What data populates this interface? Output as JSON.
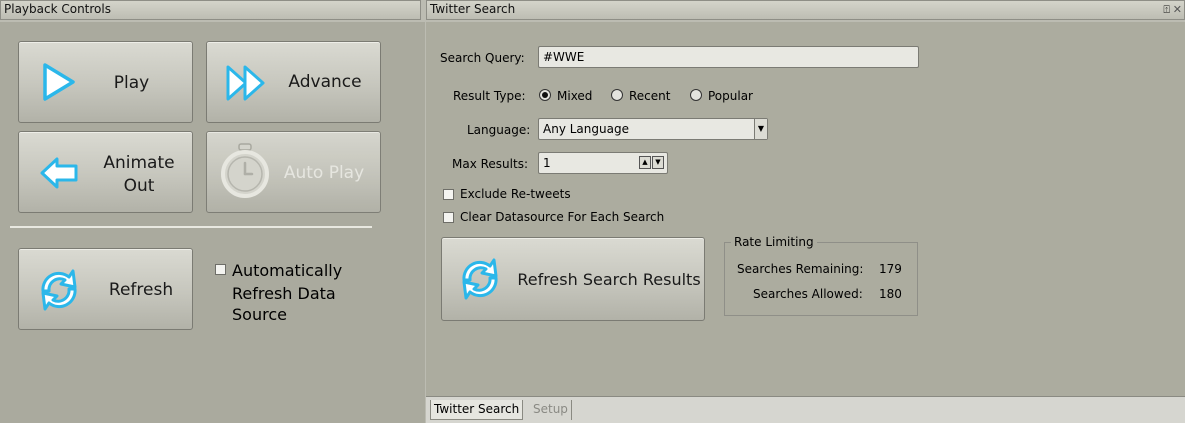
{
  "playback_panel": {
    "title": "Playback Controls",
    "buttons": {
      "play": "Play",
      "advance": "Advance",
      "animate_out_line1": "Animate",
      "animate_out_line2": "Out",
      "auto_play": "Auto Play",
      "refresh": "Refresh"
    },
    "auto_refresh": {
      "line1": "Automatically",
      "line2": "Refresh Data",
      "line3": "Source",
      "checked": false
    }
  },
  "twitter_panel": {
    "title": "Twitter Search",
    "pin_icon": "pin-icon",
    "close_icon": "close-icon",
    "search_query": {
      "label": "Search Query:",
      "value": "#WWE"
    },
    "result_type": {
      "label": "Result Type:",
      "options": [
        "Mixed",
        "Recent",
        "Popular"
      ],
      "selected": "Mixed"
    },
    "language": {
      "label": "Language:",
      "value": "Any Language"
    },
    "max_results": {
      "label": "Max Results:",
      "value": "1"
    },
    "exclude_retweets": {
      "label": "Exclude Re-tweets",
      "checked": false
    },
    "clear_datasource": {
      "label": "Clear Datasource For Each Search",
      "checked": false
    },
    "refresh_button": "Refresh Search Results",
    "rate_limiting": {
      "title": "Rate Limiting",
      "remaining_label": "Searches Remaining:",
      "remaining_value": "179",
      "allowed_label": "Searches Allowed:",
      "allowed_value": "180"
    }
  },
  "tabs": [
    "Twitter Search",
    "Setup"
  ],
  "active_tab": "Twitter Search",
  "colors": {
    "icon_blue": "#2bb7ea",
    "background": "#bcbcb2"
  }
}
